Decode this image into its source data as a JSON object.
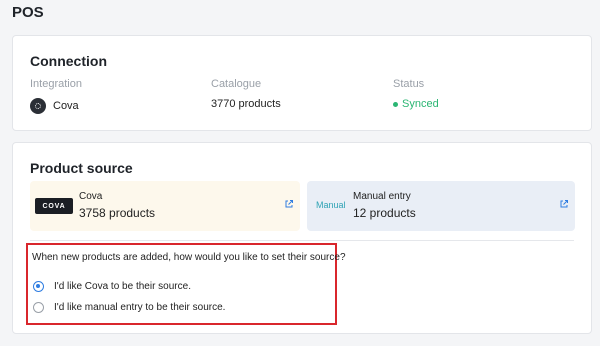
{
  "page": {
    "title": "POS"
  },
  "connection": {
    "title": "Connection",
    "columns": {
      "integration_label": "Integration",
      "catalogue_label": "Catalogue",
      "status_label": "Status"
    },
    "integration_value": "Cova",
    "catalogue_value": "3770 products",
    "status_value": "Synced",
    "status_color": "#2bb673"
  },
  "product_source": {
    "title": "Product source",
    "tiles": [
      {
        "badge": "COVA",
        "name": "Cova",
        "count": "3758 products",
        "icon": "external-link-icon"
      },
      {
        "badge": "Manual",
        "name": "Manual entry",
        "count": "12 products",
        "icon": "external-link-icon"
      }
    ],
    "question": "When new products are added, how would you like to set their source?",
    "options": [
      {
        "label": "I'd like Cova to be their source.",
        "selected": true
      },
      {
        "label": "I'd like manual entry to be their source.",
        "selected": false
      }
    ],
    "highlight_color": "#d9262c",
    "accent_color": "#2f7de1"
  }
}
